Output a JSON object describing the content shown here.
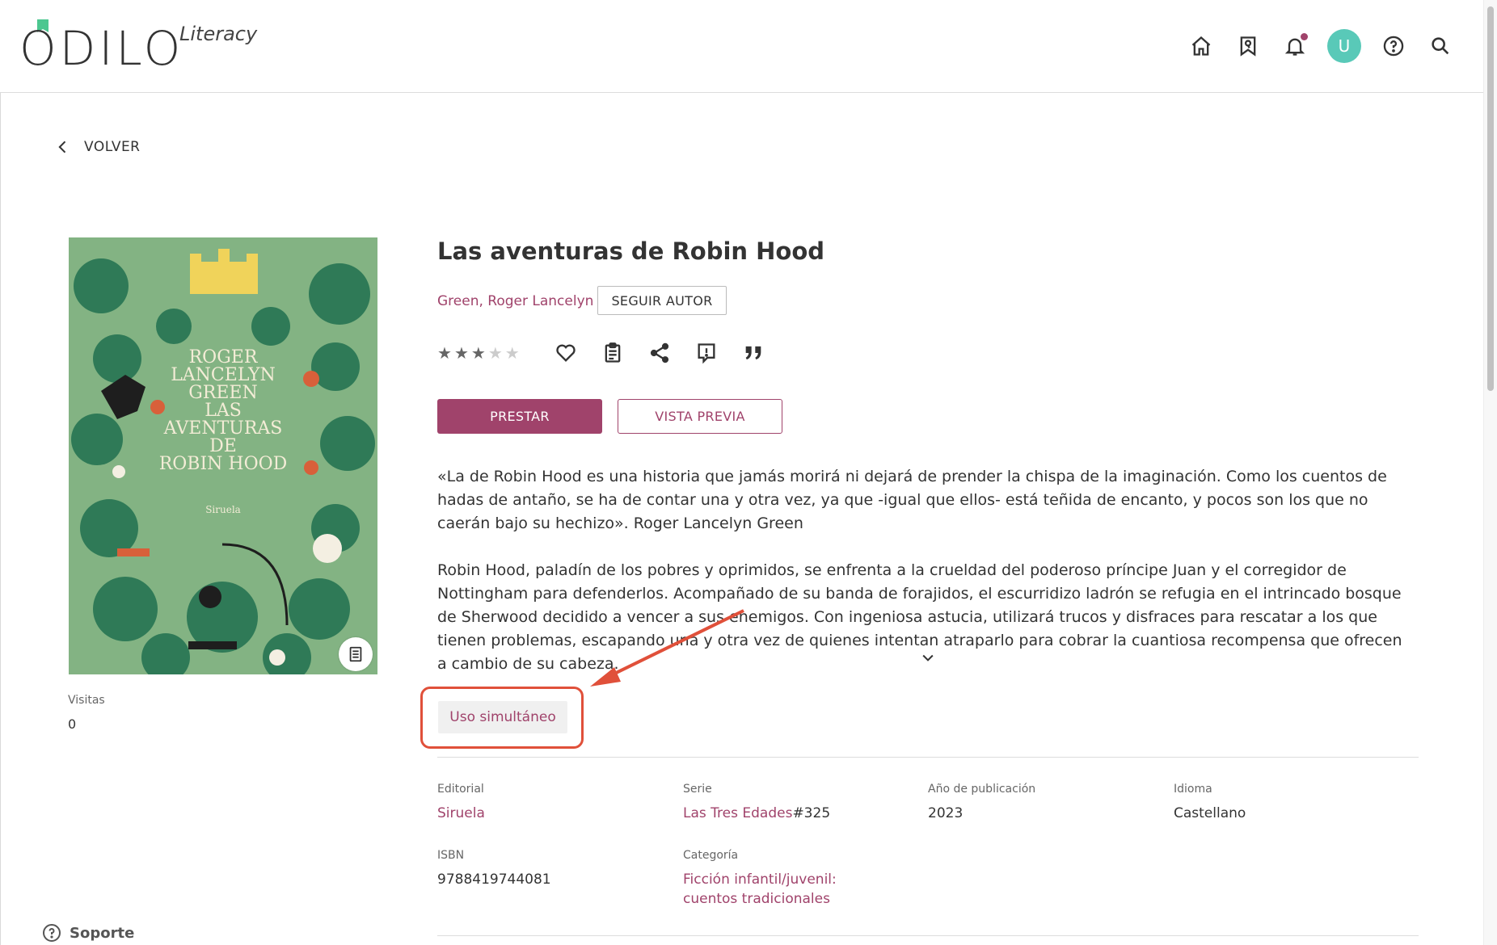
{
  "header": {
    "logo_text": "ODILO",
    "logo_sub": "Literacy",
    "avatar_initial": "U",
    "icons": [
      "home-icon",
      "bookmark-list-icon",
      "bell-icon",
      "help-icon",
      "search-icon"
    ]
  },
  "back": {
    "label": "VOLVER"
  },
  "book": {
    "title": "Las aventuras de Robin Hood",
    "author": "Green, Roger Lancelyn",
    "follow_label": "SEGUIR AUTOR",
    "rating": 3,
    "rating_max": 5,
    "borrow_label": "PRESTAR",
    "preview_label": "VISTA PREVIA",
    "description": [
      "«La de Robin Hood es una historia que jamás morirá ni dejará de prender la chispa de la imaginación. Como los cuentos de hadas de antaño, se ha de contar una y otra vez, ya que -igual que ellos- está teñida de encanto, y pocos son los que no caerán bajo su hechizo». Roger Lancelyn Green",
      "Robin Hood, paladín de los pobres y oprimidos, se enfrenta a la crueldad del poderoso príncipe Juan y el corregidor de Nottingham para defenderlos. Acompañado de su banda de forajidos, el escurridizo ladrón se refugia en el intrincado bosque de Sherwood decidido a vencer a sus enemigos. Con ingeniosa astucia, utilizará trucos y disfraces para rescatar a los que tienen problemas, escapando una y otra vez de quienes intentan atraparlo para cobrar la cuantiosa recompensa que ofrecen a cambio de su cabeza."
    ],
    "usage_tag": "Uso simultáneo"
  },
  "cover": {
    "title_lines": [
      "ROGER",
      "LANCELYN",
      "GREEN",
      "LAS",
      "AVENTURAS",
      "DE",
      "ROBIN HOOD"
    ],
    "publisher": "Siruela"
  },
  "stats": {
    "visits_label": "Visitas",
    "visits_value": "0"
  },
  "metadata": {
    "editorial_label": "Editorial",
    "editorial_value": "Siruela",
    "serie_label": "Serie",
    "serie_value": "Las Tres Edades",
    "serie_number": "#325",
    "year_label": "Año de publicación",
    "year_value": "2023",
    "language_label": "Idioma",
    "language_value": "Castellano",
    "isbn_label": "ISBN",
    "isbn_value": "9788419744081",
    "category_label": "Categoría",
    "category_value": "Ficción infantil/juvenil: cuentos tradicionales"
  },
  "support": {
    "label": "Soporte"
  },
  "colors": {
    "accent": "#a0436b",
    "avatar": "#59c9b8",
    "annotation": "#e0503a",
    "cover_green": "#7fb07c"
  }
}
